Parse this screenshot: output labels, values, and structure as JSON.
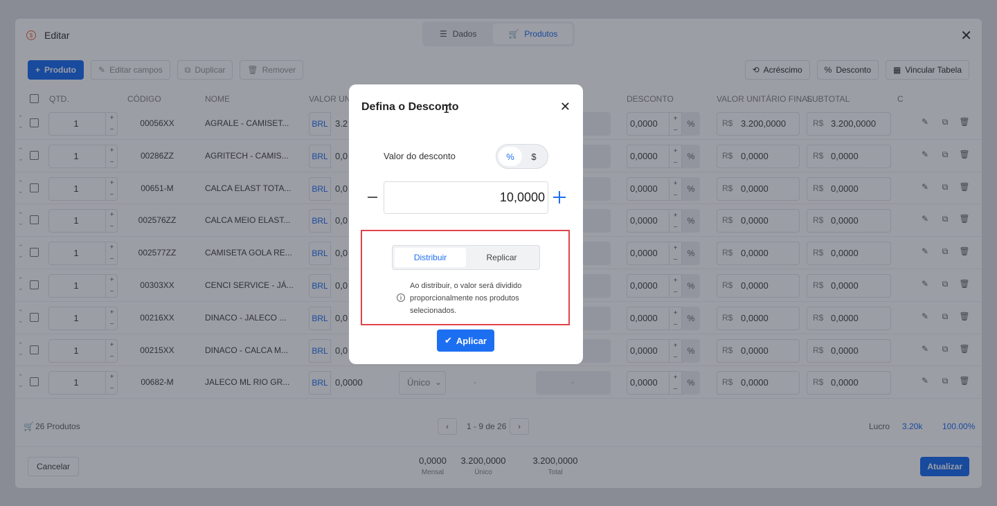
{
  "app": {
    "title": "Editar",
    "tabs": [
      {
        "label": "Dados"
      },
      {
        "label": "Produtos"
      }
    ],
    "toolbar": {
      "add_product": "Produto",
      "edit_fields": "Editar campos",
      "duplicate": "Duplicar",
      "remove": "Remover",
      "increase": "Acréscimo",
      "discount": "Desconto",
      "link_table": "Vincular Tabela"
    },
    "columns": {
      "qty": "QTD.",
      "code": "CÓDIGO",
      "name": "NOME",
      "unit_value": "VALOR UNI",
      "discount": "DESCONTO",
      "final_unit_value": "VALOR UNITÁRIO FINAL",
      "subtotal": "SUBTOTAL",
      "extra": "C"
    },
    "currency_brl": "BRL",
    "currency_rs": "R$",
    "rows": [
      {
        "qty": "1",
        "code": "00056XX",
        "name": "AGRALE - CAMISET...",
        "unit": "3.2",
        "discount": "0,0000",
        "final": "3.200,0000",
        "subtotal": "3.200,0000"
      },
      {
        "qty": "1",
        "code": "00286ZZ",
        "name": "AGRITECH - CAMIS...",
        "unit": "0,0",
        "discount": "0,0000",
        "final": "0,0000",
        "subtotal": "0,0000"
      },
      {
        "qty": "1",
        "code": "00651-M",
        "name": "CALCA ELAST TOTA...",
        "unit": "0,0",
        "discount": "0,0000",
        "final": "0,0000",
        "subtotal": "0,0000"
      },
      {
        "qty": "1",
        "code": "002576ZZ",
        "name": "CALCA MEIO ELAST...",
        "unit": "0,0",
        "discount": "0,0000",
        "final": "0,0000",
        "subtotal": "0,0000"
      },
      {
        "qty": "1",
        "code": "002577ZZ",
        "name": "CAMISETA GOLA RE...",
        "unit": "0,0",
        "discount": "0,0000",
        "final": "0,0000",
        "subtotal": "0,0000"
      },
      {
        "qty": "1",
        "code": "00303XX",
        "name": "CENCI SERVICE - JÁ...",
        "unit": "0,0",
        "discount": "0,0000",
        "final": "0,0000",
        "subtotal": "0,0000"
      },
      {
        "qty": "1",
        "code": "00216XX",
        "name": "DINACO - JALECO ...",
        "unit": "0,0",
        "discount": "0,0000",
        "final": "0,0000",
        "subtotal": "0,0000"
      },
      {
        "qty": "1",
        "code": "00215XX",
        "name": "DINACO - CALCA M...",
        "unit": "0,0",
        "discount": "0,0000",
        "final": "0,0000",
        "subtotal": "0,0000"
      },
      {
        "qty": "1",
        "code": "00682-M",
        "name": "JALECO ML RIO GR...",
        "unit": "0,0000",
        "discount": "0,0000",
        "final": "0,0000",
        "subtotal": "0,0000",
        "type": "Único",
        "dash": "-"
      }
    ],
    "footer": {
      "products_count": "26 Produtos",
      "pagination": "1 - 9 de 26",
      "profit_label": "Lucro",
      "profit_value": "3.20k",
      "profit_percent": "100.00%",
      "cancel": "Cancelar",
      "update": "Atualizar",
      "totals": [
        {
          "value": "0,0000",
          "label": "Mensal"
        },
        {
          "value": "3.200,0000",
          "label": "Único"
        },
        {
          "value": "3.200,0000",
          "label": "Total"
        }
      ]
    }
  },
  "modal": {
    "title": "Defina o Desconto",
    "value_label": "Valor do desconto",
    "type_options": [
      "%",
      "$"
    ],
    "selected_type": "%",
    "value": "10,0000",
    "unit": "%",
    "mode_options": [
      "Distribuir",
      "Replicar"
    ],
    "selected_mode": "Distribuir",
    "info": "Ao distribuir, o valor será dividido proporcionalmente nos produtos selecionados.",
    "apply": "Aplicar"
  },
  "colors": {
    "accent": "#1d6ff2",
    "highlight": "#e0434c",
    "overlay": "rgba(20,24,40,0.42)"
  },
  "icons": {
    "close": "close-icon",
    "info": "info-icon",
    "check": "check-icon",
    "minus": "minus-icon",
    "plus": "plus-icon"
  }
}
